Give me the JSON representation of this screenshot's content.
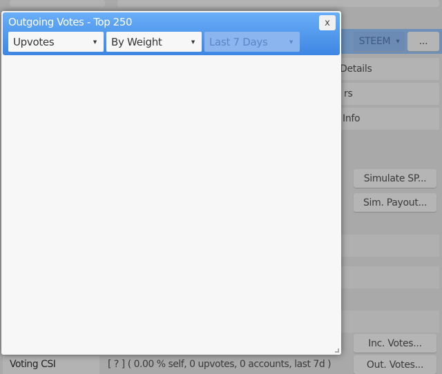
{
  "background": {
    "currency_select": "STEEM",
    "more_button": "...",
    "rows": [
      "Details",
      "rs",
      "Info"
    ],
    "simulate_sp": "Simulate SP...",
    "sim_payout": "Sim. Payout...",
    "inc_votes": "Inc. Votes...",
    "out_votes": "Out. Votes...",
    "voting_csi_label": "Voting CSI",
    "voting_csi_value": "[ ? ] ( 0.00 % self, 0 upvotes, 0 accounts, last 7d )"
  },
  "dialog": {
    "title": "Outgoing Votes - Top 250",
    "close_label": "x",
    "vote_type": "Upvotes",
    "sort": "By Weight",
    "period": "Last 7 Days"
  },
  "colors": {
    "header_top": "#6aaef8",
    "header_bottom": "#3d86e2"
  }
}
